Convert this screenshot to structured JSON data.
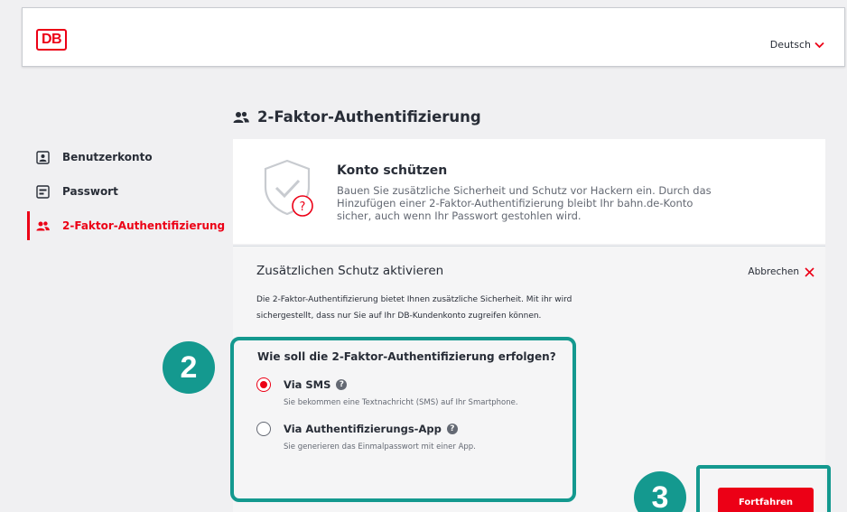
{
  "header": {
    "logo": "DB",
    "language": "Deutsch"
  },
  "page_title": "2-Faktor-Authentifizierung",
  "sidebar": {
    "items": [
      {
        "label": "Benutzerkonto",
        "icon": "user-card-icon",
        "active": false
      },
      {
        "label": "Passwort",
        "icon": "password-icon",
        "active": false
      },
      {
        "label": "2-Faktor-Authentifizierung",
        "icon": "users-icon",
        "active": true
      }
    ]
  },
  "konto_card": {
    "title": "Konto schützen",
    "text": "Bauen Sie zusätzliche Sicherheit und Schutz vor Hackern ein. Durch das Hinzufügen einer 2-Faktor-Authentifizierung bleibt Ihr bahn.de-Konto sicher, auch wenn Ihr Passwort gestohlen wird."
  },
  "activation": {
    "title": "Zusätzlichen Schutz aktivieren",
    "cancel_label": "Abbrechen",
    "intro": "Die 2-Faktor-Authentifizierung bietet Ihnen zusätzliche Sicherheit. Mit ihr wird sichergestellt, dass nur Sie auf Ihr DB-Kundenkonto zugreifen können.",
    "question": "Wie soll die 2-Faktor-Authentifizierung erfolgen?",
    "options": [
      {
        "label": "Via SMS",
        "description": "Sie bekommen eine Textnachricht (SMS) auf Ihr Smartphone.",
        "selected": true
      },
      {
        "label": "Via Authentifizierungs-App",
        "description": "Sie generieren das Einmalpasswort mit einer App.",
        "selected": false
      }
    ],
    "continue_label": "Fortfahren"
  },
  "annotations": {
    "step_2": "2",
    "step_3": "3"
  },
  "colors": {
    "brand_red": "#ec0016",
    "annotation_teal": "#14998f",
    "text_dark": "#282d37",
    "text_muted": "#646973"
  }
}
